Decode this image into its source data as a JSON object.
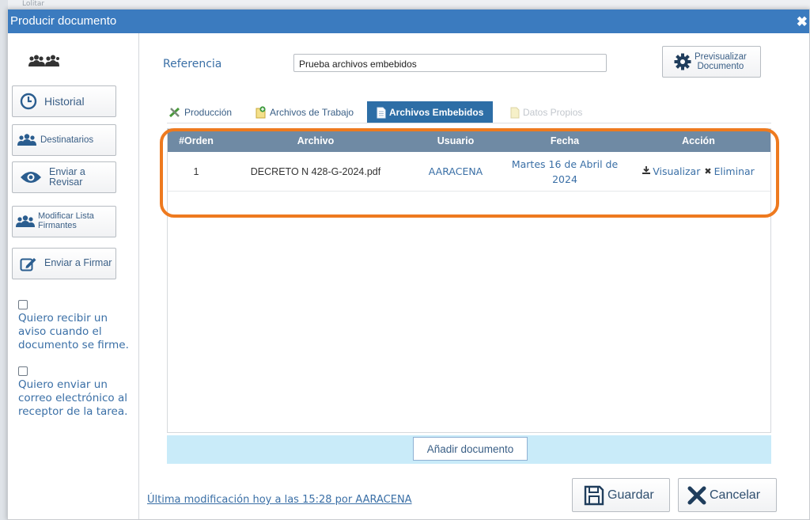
{
  "background": {
    "label": "Lolitar"
  },
  "dialog": {
    "title": "Producir documento",
    "close_symbol": "✖"
  },
  "sidebar": {
    "buttons": [
      {
        "label": "Historial",
        "icon": "clock-icon"
      },
      {
        "label": "Destinatarios",
        "icon": "group-icon"
      },
      {
        "label": "Enviar a Revisar",
        "icon": "eye-icon"
      },
      {
        "label": "Modificar Lista Firmantes",
        "icon": "group-icon"
      },
      {
        "label": "Enviar a Firmar",
        "icon": "edit-icon"
      }
    ],
    "checkboxes": [
      {
        "label": "Quiero recibir un aviso cuando el documento se firme.",
        "checked": false
      },
      {
        "label": "Quiero enviar un correo electrónico al receptor de la tarea.",
        "checked": false
      }
    ]
  },
  "main": {
    "reference_label": "Referencia",
    "reference_value": "Prueba archivos embebidos",
    "preview_button": {
      "line1": "Previsualizar",
      "line2": "Documento"
    },
    "tabs": [
      {
        "label": "Producción",
        "state": "normal"
      },
      {
        "label": "Archivos de Trabajo",
        "state": "normal"
      },
      {
        "label": "Archivos Embebidos",
        "state": "active"
      },
      {
        "label": "Datos Propios",
        "state": "disabled"
      }
    ],
    "table": {
      "headers": [
        "#Orden",
        "Archivo",
        "Usuario",
        "Fecha",
        "Acción"
      ],
      "rows": [
        {
          "order": "1",
          "file": "DECRETO N 428-G-2024.pdf",
          "user": "AARACENA",
          "date_line1": "Martes 16 de Abril de",
          "date_line2": "2024",
          "action_view": "Visualizar",
          "action_delete": "Eliminar"
        }
      ]
    },
    "add_button": "Añadir documento",
    "last_modified": "Última modificación hoy a las 15:28 por AARACENA",
    "save_button": "Guardar",
    "cancel_button": "Cancelar"
  },
  "colors": {
    "titlebar": "#3b7bbf",
    "active_tab": "#2d6ea6",
    "table_header": "#6f8aa4",
    "highlight": "#ee7a1f",
    "add_bar": "#c9ebf9",
    "link": "#3a6fa6"
  }
}
